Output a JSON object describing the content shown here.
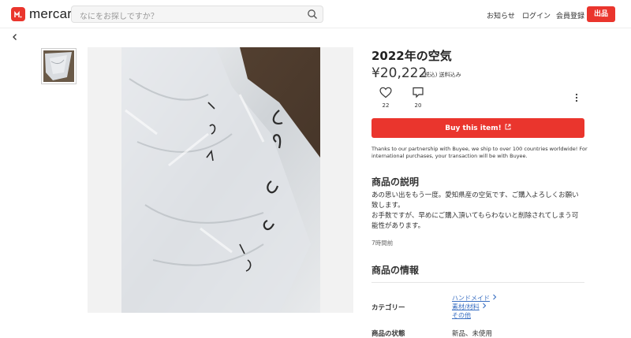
{
  "header": {
    "logo_text": "mercari",
    "search_placeholder": "なにをお探しですか？",
    "nav": {
      "notifications": "お知らせ",
      "login": "ログイン",
      "register": "会員登録"
    },
    "sell_label": "出品"
  },
  "item": {
    "title": "2022年の空気",
    "price": "¥20,222",
    "price_note": "(税込) 送料込み",
    "likes": "22",
    "comments": "20",
    "buy_label": "Buy this item!",
    "buyee_note": "Thanks to our partnership with Buyee, we ship to over 100 countries worldwide! For international purchases, your transaction will be with Buyee.",
    "description_title": "商品の説明",
    "description_lines": [
      "あの思い出をもう一度。愛知県産の空気です、ご購入よろしくお願い",
      "致します。",
      "お手数ですが、早めにご購入頂いてもらわないと削除されてしまう可",
      "能性があります。"
    ],
    "posted": "7時間前",
    "info_title": "商品の情報",
    "category_label": "カテゴリー",
    "categories": [
      "ハンドメイド",
      "素材/材料",
      "その他"
    ],
    "condition_label": "商品の状態",
    "condition_value": "新品、未使用"
  },
  "icons": {
    "back": "chevron-left-icon",
    "search": "search-icon",
    "like": "heart-icon",
    "comment": "comment-icon",
    "more": "more-vertical-icon",
    "external": "external-link-icon"
  },
  "colors": {
    "brand": "#ea352d",
    "link": "#3a6fc2"
  }
}
